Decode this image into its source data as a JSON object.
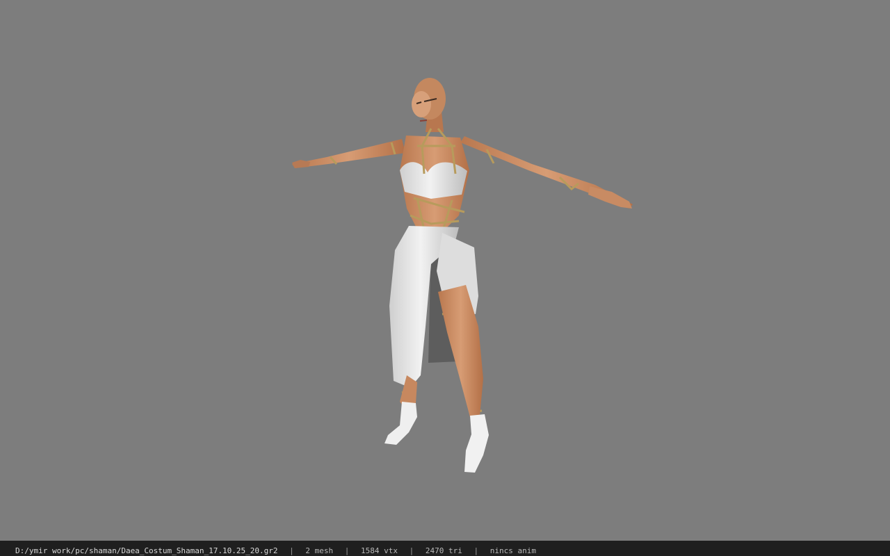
{
  "viewport": {
    "background": "#7d7d7d"
  },
  "model": {
    "skin_color": "#c58a63",
    "dress_color": "#e6e6e6",
    "gold_color": "#b79b5c"
  },
  "statusbar": {
    "file_path": "D:/ymir work/pc/shaman/Daea_Costum_Shaman_17.10.25_20.gr2",
    "separator": "|",
    "mesh": "2 mesh",
    "vtx": "1584 vtx",
    "tri": "2470 tri",
    "anim": "nincs anim"
  }
}
